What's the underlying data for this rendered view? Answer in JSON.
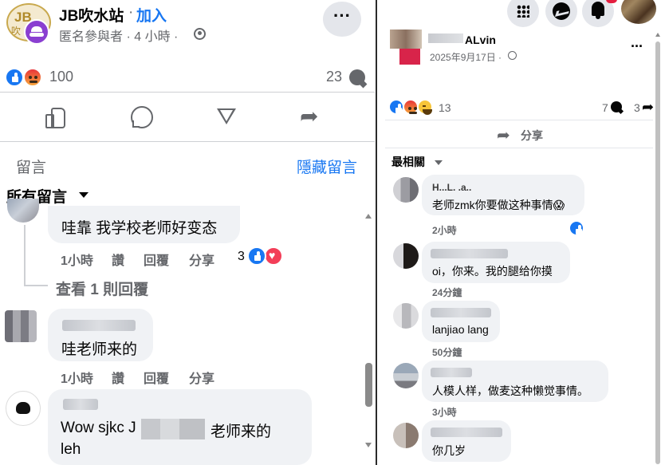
{
  "left": {
    "logo": {
      "text_top": "JB",
      "text_bottom": "吹"
    },
    "page_name": "JB吹水站",
    "separator": "·",
    "join_label": "加入",
    "poster": "匿名參與者",
    "time": " · 4 小時 · ",
    "reaction_count": "100",
    "comment_count": "23",
    "comments_label": "留言",
    "hide_comments_label": "隱藏留言",
    "all_comments_label": "所有留言",
    "comments": [
      {
        "text": "哇靠 我学校老师好变态",
        "time": "1小時",
        "like": "讚",
        "reply": "回覆",
        "share": "分享",
        "reaction_count": "3"
      },
      {
        "text": "哇老师来的",
        "time": "1小時",
        "like": "讚",
        "reply": "回覆",
        "share": "分享"
      },
      {
        "text_line1_a": "Wow sjkc J",
        "text_line1_b": "老师来的",
        "text_line2": "leh"
      }
    ],
    "view_replies": "查看 1 則回覆"
  },
  "right": {
    "author": "ALvin",
    "date": "2025年9月17日 · ",
    "reaction_count": "13",
    "comment_count": "7",
    "share_count": "3",
    "share_label": "分享",
    "sort_label": "最相關",
    "comments": [
      {
        "name_partial": "H...L. .a..",
        "text": "老师zmk你要做这种事情😱",
        "time": "2小時"
      },
      {
        "text": "oi，你来。我的腿给你摸",
        "time": "24分鐘"
      },
      {
        "text": "lanjiao lang",
        "time": "50分鐘"
      },
      {
        "text": "人模人样，做麦这种懒觉事情。",
        "time": "3小時"
      },
      {
        "text": "你几岁"
      }
    ]
  },
  "colors": {
    "brand_blue": "#1877f2",
    "secondary_text": "#65676b",
    "bubble_bg": "#f0f2f5",
    "anon_purple": "#8a3fd1"
  }
}
